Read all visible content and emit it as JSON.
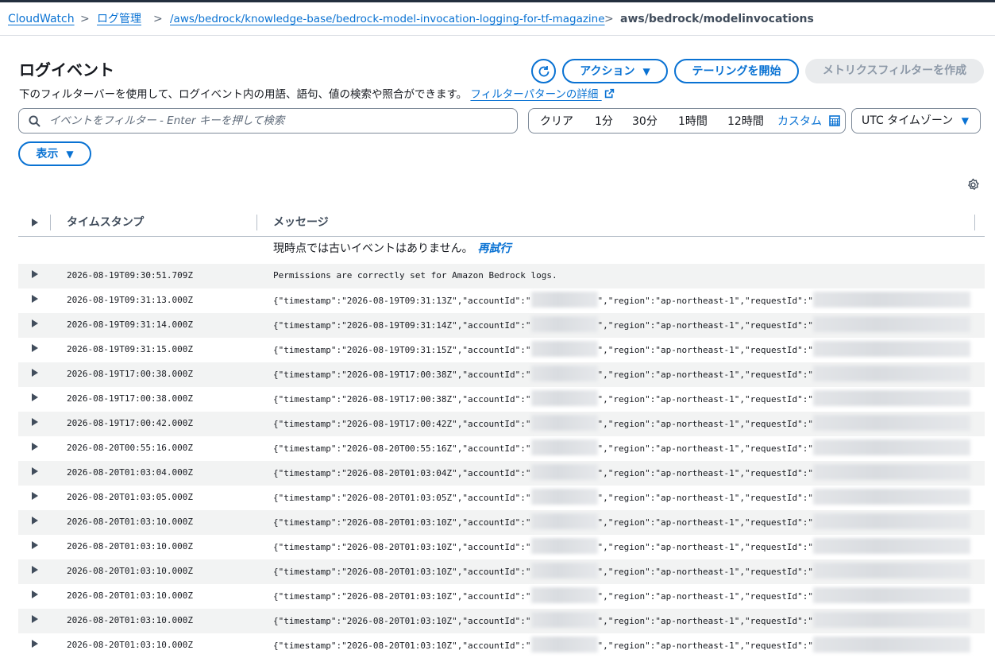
{
  "breadcrumb": {
    "items": [
      "CloudWatch",
      "ログ管理",
      "/aws/bedrock/knowledge-base/bedrock-model-invocation-logging-for-tf-magazine"
    ],
    "current": "aws/bedrock/modelinvocations",
    "separator": ">"
  },
  "header": {
    "title": "ログイベント",
    "description": "下のフィルターバーを使用して、ログイベント内の用語、語句、値の検索や照合ができます。",
    "description_link": "フィルターパターンの詳細",
    "actions_label": "アクション",
    "tail_label": "テーリングを開始",
    "metric_filter_label": "メトリクスフィルターを作成"
  },
  "search": {
    "placeholder": "イベントをフィルター - Enter キーを押して検索"
  },
  "time_range": {
    "options": [
      "クリア",
      "1分",
      "30分",
      "1時間",
      "12時間"
    ],
    "custom_label": "カスタム"
  },
  "timezone": {
    "selected": "UTC タイムゾーン"
  },
  "display_label": "表示",
  "table": {
    "columns": [
      "タイムスタンプ",
      "メッセージ"
    ],
    "notice": "現時点では古いイベントはありません。",
    "retry_label": "再試行",
    "rows": [
      {
        "timestamp": "2026-08-19T09:30:51.709Z",
        "message": "Permissions are correctly set for Amazon Bedrock logs."
      },
      {
        "timestamp": "2026-08-19T09:31:13.000Z",
        "message": "{\"timestamp\":\"2026-08-19T09:31:13Z\",\"accountId\":\"",
        "message_mid": "\",\"region\":\"ap-northeast-1\",\"requestId\":\""
      },
      {
        "timestamp": "2026-08-19T09:31:14.000Z",
        "message": "{\"timestamp\":\"2026-08-19T09:31:14Z\",\"accountId\":\"",
        "message_mid": "\",\"region\":\"ap-northeast-1\",\"requestId\":\""
      },
      {
        "timestamp": "2026-08-19T09:31:15.000Z",
        "message": "{\"timestamp\":\"2026-08-19T09:31:15Z\",\"accountId\":\"",
        "message_mid": "\",\"region\":\"ap-northeast-1\",\"requestId\":\""
      },
      {
        "timestamp": "2026-08-19T17:00:38.000Z",
        "message": "{\"timestamp\":\"2026-08-19T17:00:38Z\",\"accountId\":\"",
        "message_mid": "\",\"region\":\"ap-northeast-1\",\"requestId\":\""
      },
      {
        "timestamp": "2026-08-19T17:00:38.000Z",
        "message": "{\"timestamp\":\"2026-08-19T17:00:38Z\",\"accountId\":\"",
        "message_mid": "\",\"region\":\"ap-northeast-1\",\"requestId\":\""
      },
      {
        "timestamp": "2026-08-19T17:00:42.000Z",
        "message": "{\"timestamp\":\"2026-08-19T17:00:42Z\",\"accountId\":\"",
        "message_mid": "\",\"region\":\"ap-northeast-1\",\"requestId\":\""
      },
      {
        "timestamp": "2026-08-20T00:55:16.000Z",
        "message": "{\"timestamp\":\"2026-08-20T00:55:16Z\",\"accountId\":\"",
        "message_mid": "\",\"region\":\"ap-northeast-1\",\"requestId\":\""
      },
      {
        "timestamp": "2026-08-20T01:03:04.000Z",
        "message": "{\"timestamp\":\"2026-08-20T01:03:04Z\",\"accountId\":\"",
        "message_mid": "\",\"region\":\"ap-northeast-1\",\"requestId\":\""
      },
      {
        "timestamp": "2026-08-20T01:03:05.000Z",
        "message": "{\"timestamp\":\"2026-08-20T01:03:05Z\",\"accountId\":\"",
        "message_mid": "\",\"region\":\"ap-northeast-1\",\"requestId\":\""
      },
      {
        "timestamp": "2026-08-20T01:03:10.000Z",
        "message": "{\"timestamp\":\"2026-08-20T01:03:10Z\",\"accountId\":\"",
        "message_mid": "\",\"region\":\"ap-northeast-1\",\"requestId\":\""
      },
      {
        "timestamp": "2026-08-20T01:03:10.000Z",
        "message": "{\"timestamp\":\"2026-08-20T01:03:10Z\",\"accountId\":\"",
        "message_mid": "\",\"region\":\"ap-northeast-1\",\"requestId\":\""
      },
      {
        "timestamp": "2026-08-20T01:03:10.000Z",
        "message": "{\"timestamp\":\"2026-08-20T01:03:10Z\",\"accountId\":\"",
        "message_mid": "\",\"region\":\"ap-northeast-1\",\"requestId\":\""
      },
      {
        "timestamp": "2026-08-20T01:03:10.000Z",
        "message": "{\"timestamp\":\"2026-08-20T01:03:10Z\",\"accountId\":\"",
        "message_mid": "\",\"region\":\"ap-northeast-1\",\"requestId\":\""
      },
      {
        "timestamp": "2026-08-20T01:03:10.000Z",
        "message": "{\"timestamp\":\"2026-08-20T01:03:10Z\",\"accountId\":\"",
        "message_mid": "\",\"region\":\"ap-northeast-1\",\"requestId\":\""
      },
      {
        "timestamp": "2026-08-20T01:03:10.000Z",
        "message": "{\"timestamp\":\"2026-08-20T01:03:10Z\",\"accountId\":\"",
        "message_mid": "\",\"region\":\"ap-northeast-1\",\"requestId\":\""
      }
    ]
  },
  "icons": {
    "refresh": "refresh-icon",
    "external_link": "external-link-icon",
    "search": "search-icon",
    "calendar": "calendar-icon",
    "settings": "gear-icon",
    "expand": "expand-caret-icon"
  },
  "colors": {
    "accent": "#0972d3",
    "text": "#16191f",
    "row_alt": "#f2f3f3",
    "disabled_bg": "#e9ebed"
  }
}
